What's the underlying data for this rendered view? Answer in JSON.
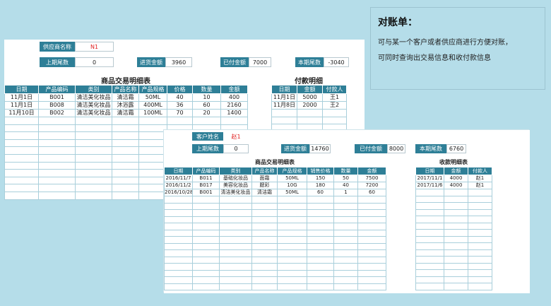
{
  "note": {
    "title": "对账单：",
    "line1": "可与某一个客户或者供应商进行方便对账，",
    "line2": "可同时查询出交易信息和收付款信息"
  },
  "supplier": {
    "name_label": "供应商名称",
    "name_value": "N1",
    "prev_label": "上期尾数",
    "prev_value": "0",
    "purchase_label": "进货金额",
    "purchase_value": "3960",
    "paid_label": "已付金额",
    "paid_value": "7000",
    "current_label": "本期尾数",
    "current_value": "-3040",
    "trade_title": "商品交易明细表",
    "trade_headers": [
      "日期",
      "产品编码",
      "类别",
      "产品名称",
      "产品规格",
      "价格",
      "数量",
      "金额"
    ],
    "trade_rows": [
      [
        "11月1日",
        "B001",
        "清洁美化妆品",
        "清洁霜",
        "50ML",
        "40",
        "10",
        "400"
      ],
      [
        "11月1日",
        "B008",
        "清洁美化妆品",
        "沐浴露",
        "400ML",
        "36",
        "60",
        "2160"
      ],
      [
        "11月10日",
        "B002",
        "清洁美化妆品",
        "清洁霜",
        "100ML",
        "70",
        "20",
        "1400"
      ]
    ],
    "pay_title": "付款明细",
    "pay_headers": [
      "日期",
      "金额",
      "付款人"
    ],
    "pay_rows": [
      [
        "11月1日",
        "5000",
        "王1"
      ],
      [
        "11月8日",
        "2000",
        "王2"
      ]
    ]
  },
  "customer": {
    "name_label": "客户姓名",
    "name_value": "赵1",
    "prev_label": "上期尾数",
    "prev_value": "0",
    "purchase_label": "进货金额",
    "purchase_value": "14760",
    "paid_label": "已付金额",
    "paid_value": "8000",
    "current_label": "本期尾数",
    "current_value": "6760",
    "trade_title": "商品交易明细表",
    "trade_headers": [
      "日期",
      "产品编码",
      "类别",
      "产品名称",
      "产品规格",
      "销售价格",
      "数量",
      "金额"
    ],
    "trade_rows": [
      [
        "2016/11/7",
        "B011",
        "基础化妆品",
        "面霜",
        "50ML",
        "150",
        "50",
        "7500"
      ],
      [
        "2016/11/2",
        "B017",
        "美容化妆品",
        "腮彩",
        "10G",
        "180",
        "40",
        "7200"
      ],
      [
        "2016/10/28",
        "B001",
        "清洁美化妆品",
        "清洁霜",
        "50ML",
        "60",
        "1",
        "60"
      ]
    ],
    "recv_title": "收款明细表",
    "recv_headers": [
      "日期",
      "金额",
      "付款人"
    ],
    "recv_rows": [
      [
        "2017/11/1",
        "4000",
        "赵1"
      ],
      [
        "2017/11/6",
        "4000",
        "赵1"
      ]
    ]
  }
}
